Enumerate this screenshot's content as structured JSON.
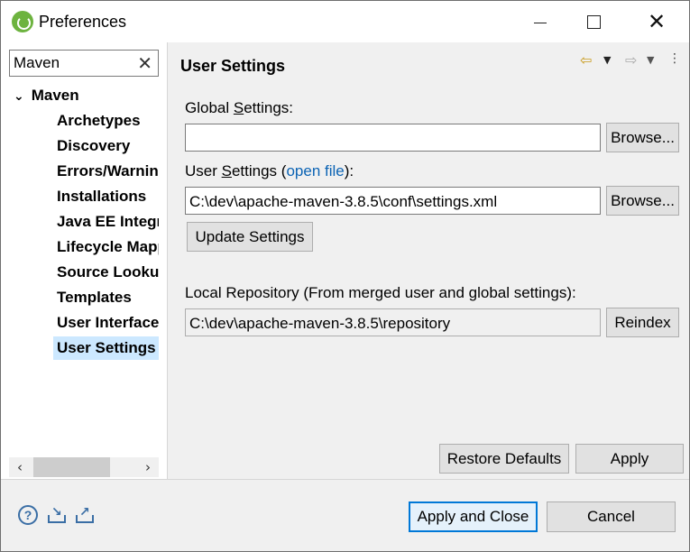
{
  "window": {
    "title": "Preferences",
    "controls": {
      "minimize": "minimize",
      "maximize": "maximize",
      "close": "✕"
    }
  },
  "sidebar": {
    "filter_value": "Maven",
    "filter_clear": "✕",
    "root": {
      "label": "Maven",
      "expanded": true
    },
    "items": [
      {
        "label": "Archetypes"
      },
      {
        "label": "Discovery"
      },
      {
        "label": "Errors/Warnings"
      },
      {
        "label": "Installations"
      },
      {
        "label": "Java EE Integration"
      },
      {
        "label": "Lifecycle Mappings"
      },
      {
        "label": "Source Lookup"
      },
      {
        "label": "Templates"
      },
      {
        "label": "User Interface"
      },
      {
        "label": "User Settings",
        "selected": true
      }
    ],
    "scroll_left": "‹",
    "scroll_right": "›"
  },
  "page": {
    "title": "User Settings",
    "global_settings": {
      "label_pre": "Global ",
      "label_mnemonic": "S",
      "label_post": "ettings:",
      "value": "",
      "browse_label": "Browse..."
    },
    "user_settings": {
      "label_pre": "User ",
      "label_mnemonic": "S",
      "label_post": "ettings (",
      "link": "open file",
      "label_end": "):",
      "value": "C:\\dev\\apache-maven-3.8.5\\conf\\settings.xml",
      "browse_label": "Browse..."
    },
    "update_settings_label": "Update Settings",
    "local_repository": {
      "label": "Local Repository (From merged user and global settings):",
      "value": "C:\\dev\\apache-maven-3.8.5\\repository",
      "reindex_label": "Reindex"
    },
    "restore_defaults_label": "Restore Defaults",
    "apply_label": "Apply"
  },
  "footer": {
    "apply_and_close_label": "Apply and Close",
    "cancel_label": "Cancel",
    "icons": [
      "help-icon",
      "import-icon",
      "export-icon"
    ]
  },
  "colors": {
    "selection": "#cce8ff",
    "link": "#0b63b4",
    "default_button_border": "#0078d7"
  }
}
